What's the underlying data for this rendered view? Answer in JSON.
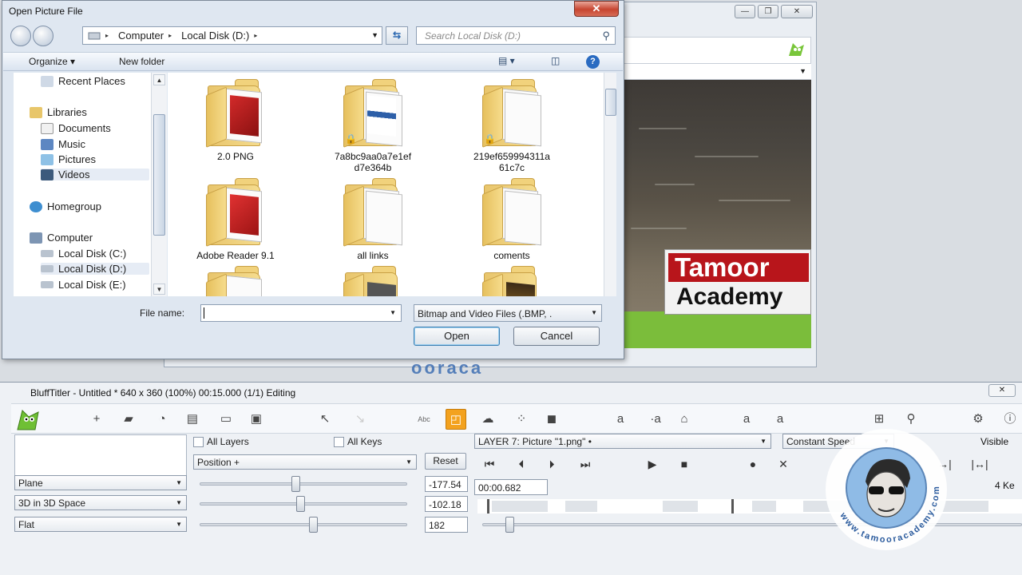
{
  "background_window": {
    "logo_line1": "Tamoor",
    "logo_line2": "Academy",
    "watermark": "ooraca"
  },
  "dialog": {
    "title": "Open Picture File",
    "close_glyph": "✕",
    "address": [
      "Computer",
      "Local Disk (D:)"
    ],
    "search_placeholder": "Search Local Disk (D:)",
    "commands": {
      "organize": "Organize ▾",
      "new_folder": "New folder",
      "help": "?"
    },
    "nav": {
      "recent": "Recent Places",
      "libraries": "Libraries",
      "documents": "Documents",
      "music": "Music",
      "pictures": "Pictures",
      "videos": "Videos",
      "homegroup": "Homegroup",
      "computer": "Computer",
      "disk_c": "Local Disk (C:)",
      "disk_d": "Local Disk (D:)",
      "disk_e": "Local Disk (E:)"
    },
    "folders": [
      {
        "name": "2.0 PNG",
        "line2": ""
      },
      {
        "name": "7a8bc9aa0a7e1ef",
        "line2": "d7e364b"
      },
      {
        "name": "219ef659994311a",
        "line2": "61c7c"
      },
      {
        "name": "Adobe Reader 9.1",
        "line2": ""
      },
      {
        "name": "all links",
        "line2": ""
      },
      {
        "name": "coments",
        "line2": ""
      },
      {
        "name": "",
        "line2": ""
      },
      {
        "name": "",
        "line2": ""
      },
      {
        "name": "",
        "line2": ""
      }
    ],
    "file_name_label": "File name:",
    "file_name_value": "",
    "file_type": "Bitmap and Video Files (.BMP, .",
    "open_label": "Open",
    "cancel_label": "Cancel"
  },
  "main": {
    "title": "BluffTitler - Untitled * 640 x 360 (100%) 00:15.000 (1/1) Editing",
    "close_glyph": "✕",
    "checks": {
      "all_layers": "All Layers",
      "all_keys": "All Keys"
    },
    "property_select": "Position +",
    "reset_label": "Reset",
    "selects": [
      "Plane",
      "3D in 3D Space",
      "Flat"
    ],
    "values": [
      "-177.54",
      "-102.18",
      "182"
    ],
    "layer_select": "LAYER 7: Picture \"1.png\" •",
    "speed_select": "Constant Speed",
    "visible_label": "Visible",
    "keys_label": "4 Ke",
    "time": "00:00.682",
    "toolbar_text": {
      "abc": "Abc",
      "a1": "a",
      "a2": "·a",
      "a3": "a",
      "a4": "a",
      "a5": "a"
    },
    "transport_icons": [
      "⏮",
      "⏴",
      "⏵",
      "⏭",
      "▶",
      "■",
      "●",
      "✕"
    ]
  },
  "badge": {
    "ring_text": "www.tamooracademy.com"
  },
  "colors": {
    "accent_orange": "#f3a21f",
    "logo_red": "#b8151b",
    "banner_green": "#7bbd3b",
    "badge_blue": "#8fbbe6"
  }
}
